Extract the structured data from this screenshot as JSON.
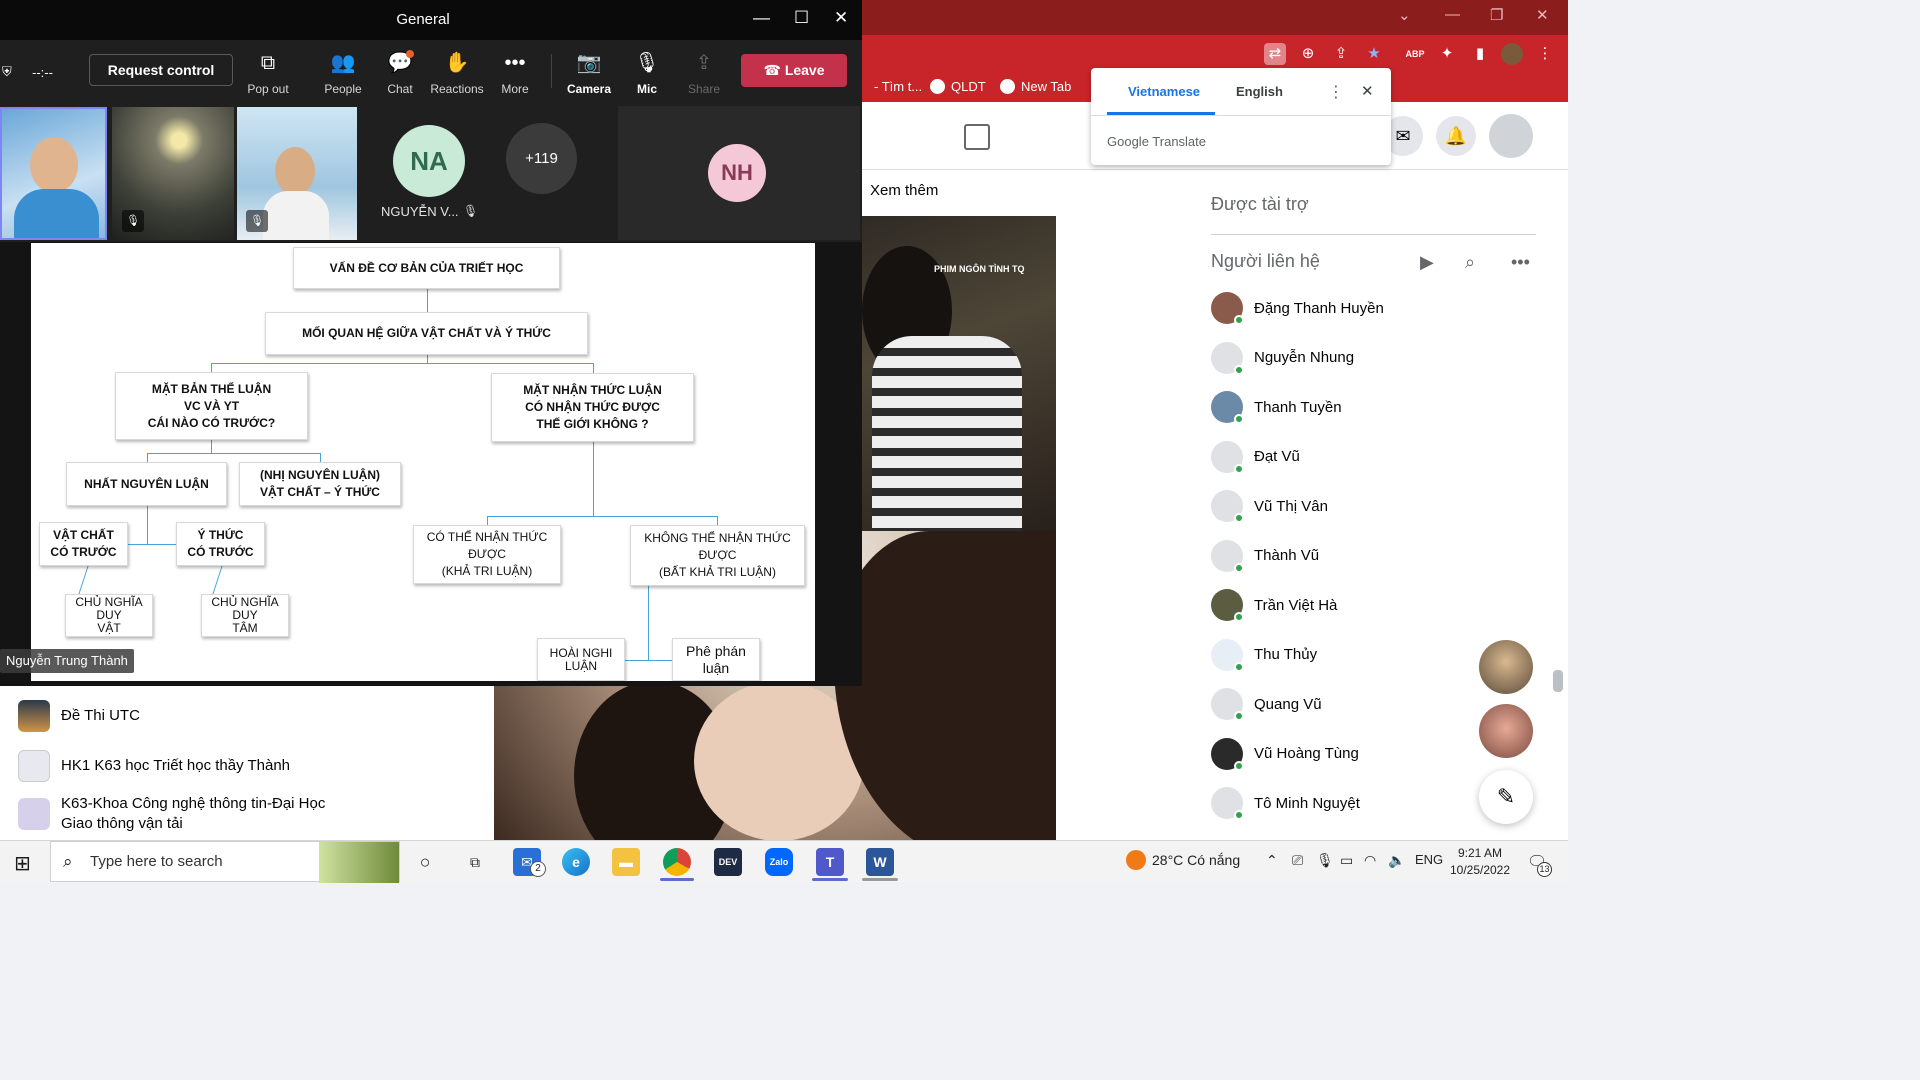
{
  "teams": {
    "title": "General",
    "timer": "--:--",
    "request_control": "Request control",
    "toolbar": [
      {
        "label": "Pop out",
        "icon": "pop-out-icon"
      },
      {
        "label": "People",
        "icon": "people-icon"
      },
      {
        "label": "Chat",
        "icon": "chat-icon"
      },
      {
        "label": "Reactions",
        "icon": "reactions-icon"
      },
      {
        "label": "More",
        "icon": "more-icon"
      },
      {
        "label": "Camera",
        "icon": "camera-off-icon"
      },
      {
        "label": "Mic",
        "icon": "mic-off-icon"
      },
      {
        "label": "Share",
        "icon": "share-icon"
      }
    ],
    "leave": "Leave",
    "participants": {
      "na_initials": "NA",
      "na_name": "NGUYỄN V...",
      "more_count": "+119",
      "nh_initials": "NH"
    },
    "presenter": "Nguyễn Trung Thành",
    "slide": {
      "root": "VẤN ĐỀ CƠ BẢN CỦA TRIẾT HỌC",
      "relation": "MỐI QUAN HỆ GIỮA VẬT CHẤT VÀ Ý THỨC",
      "ontology": "MẶT BẢN THỂ LUẬN\nVC VÀ YT\nCÁI NÀO CÓ TRƯỚC?",
      "epistemology": "MẶT NHẬN THỨC LUẬN\nCÓ NHẬN THỨC ĐƯỢC\nTHẾ GIỚI KHÔNG ?",
      "monism": "NHẤT NGUYÊN LUẬN",
      "dualism": "(NHỊ NGUYÊN LUẬN)\nVẬT CHẤT – Ý THỨC",
      "matter_first": "VẬT CHẤT\nCÓ TRƯỚC",
      "mind_first": "Ý THỨC\nCÓ TRƯỚC",
      "materialism": "CHỦ NGHĨA DUY\nVẬT",
      "idealism": "CHỦ NGHĨA DUY\nTÂM",
      "knowable": "CÓ THỂ NHẬN THỨC ĐƯỢC\n(KHẢ TRI LUẬN)",
      "unknowable": "KHÔNG THỂ NHẬN THỨC ĐƯỢC\n(BẤT KHẢ TRI LUẬN)",
      "skepticism": "HOÀI NGHI\nLUẬN",
      "critique": "Phê phán\nluận"
    }
  },
  "chrome": {
    "bookmarks": [
      "- Tìm t...",
      "QLDT",
      "New Tab"
    ],
    "translate": {
      "tab_vi": "Vietnamese",
      "tab_en": "English",
      "brand": "Google Translate"
    }
  },
  "facebook": {
    "see_more": "Xem thêm",
    "video_caption": "PHIM NGÔN TÌNH TQ",
    "sponsored": "Được tài trợ",
    "contacts_title": "Người liên hệ",
    "contacts": [
      "Đặng Thanh Huyền",
      "Nguyễn Nhung",
      "Thanh Tuyền",
      "Đạt Vũ",
      "Vũ Thị Vân",
      "Thành Vũ",
      "Trần Việt Hà",
      "Thu Thủy",
      "Quang Vũ",
      "Vũ Hoàng Tùng",
      "Tô Minh Nguyệt"
    ],
    "groups": [
      "Đề Thi UTC",
      "HK1 K63 học Triết học thầy Thành",
      "K63-Khoa Công nghệ thông tin-Đại Học Giao thông vận tải"
    ]
  },
  "taskbar": {
    "search_placeholder": "Type here to search",
    "mail_badge": "2",
    "weather": "28°C  Có nắng",
    "lang": "ENG",
    "time": "9:21 AM",
    "date": "10/25/2022",
    "notif_count": "13"
  },
  "colors": {
    "teams_leave": "#c4314b",
    "chrome_red": "#c8252a",
    "online": "#31a24c",
    "diagram_line": "#4aa3d8"
  }
}
